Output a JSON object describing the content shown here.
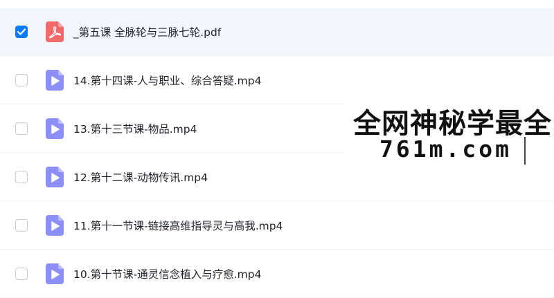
{
  "files": [
    {
      "name": "_第五课 全脉轮与三脉七轮.pdf",
      "type": "pdf",
      "checked": true
    },
    {
      "name": "14.第十四课-人与职业、综合答疑.mp4",
      "type": "video",
      "checked": false
    },
    {
      "name": "13.第十三节课-物品.mp4",
      "type": "video",
      "checked": false
    },
    {
      "name": "12.第十二课-动物传讯.mp4",
      "type": "video",
      "checked": false
    },
    {
      "name": "11.第十一节课-链接高维指导灵与高我.mp4",
      "type": "video",
      "checked": false
    },
    {
      "name": "10.第十节课-通灵信念植入与疗愈.mp4",
      "type": "video",
      "checked": false
    }
  ],
  "watermark": {
    "line1": "全网神秘学最全",
    "line2": "761m.com"
  },
  "colors": {
    "accent": "#0a7bf6",
    "pdf_icon": "#f26a6a",
    "video_icon": "#8b8ff7",
    "selected_row": "#f2f7fe"
  }
}
